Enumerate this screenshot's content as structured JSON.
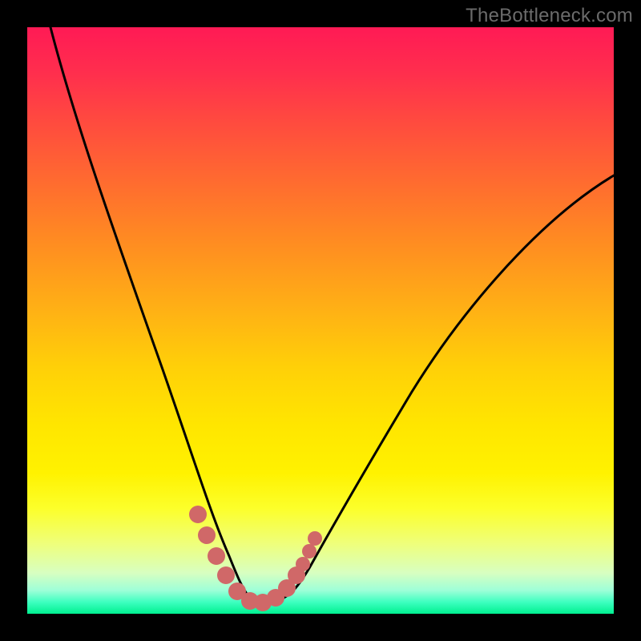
{
  "watermark": "TheBottleneck.com",
  "chart_data": {
    "type": "line",
    "title": "",
    "xlabel": "",
    "ylabel": "",
    "xlim": [
      0,
      1
    ],
    "ylim": [
      0,
      1
    ],
    "series": [
      {
        "name": "bottleneck-curve",
        "x": [
          0.04,
          0.08,
          0.12,
          0.16,
          0.2,
          0.24,
          0.27,
          0.29,
          0.31,
          0.33,
          0.35,
          0.37,
          0.39,
          0.41,
          0.43,
          0.47,
          0.52,
          0.58,
          0.66,
          0.76,
          0.88,
          1.0
        ],
        "y": [
          1.0,
          0.86,
          0.72,
          0.58,
          0.45,
          0.32,
          0.22,
          0.16,
          0.11,
          0.07,
          0.04,
          0.025,
          0.02,
          0.025,
          0.04,
          0.09,
          0.17,
          0.27,
          0.38,
          0.49,
          0.59,
          0.67
        ]
      }
    ],
    "markers": {
      "name": "highlight-points",
      "color": "#d36a6a",
      "x": [
        0.29,
        0.31,
        0.33,
        0.35,
        0.37,
        0.39,
        0.41,
        0.43,
        0.45,
        0.47,
        0.48
      ],
      "y": [
        0.16,
        0.11,
        0.07,
        0.04,
        0.025,
        0.02,
        0.025,
        0.04,
        0.06,
        0.09,
        0.11
      ]
    },
    "gradient_stops": [
      {
        "pos": 0.0,
        "color": "#ff1a55"
      },
      {
        "pos": 0.5,
        "color": "#ffd000"
      },
      {
        "pos": 0.82,
        "color": "#fcff2a"
      },
      {
        "pos": 1.0,
        "color": "#00f090"
      }
    ]
  }
}
